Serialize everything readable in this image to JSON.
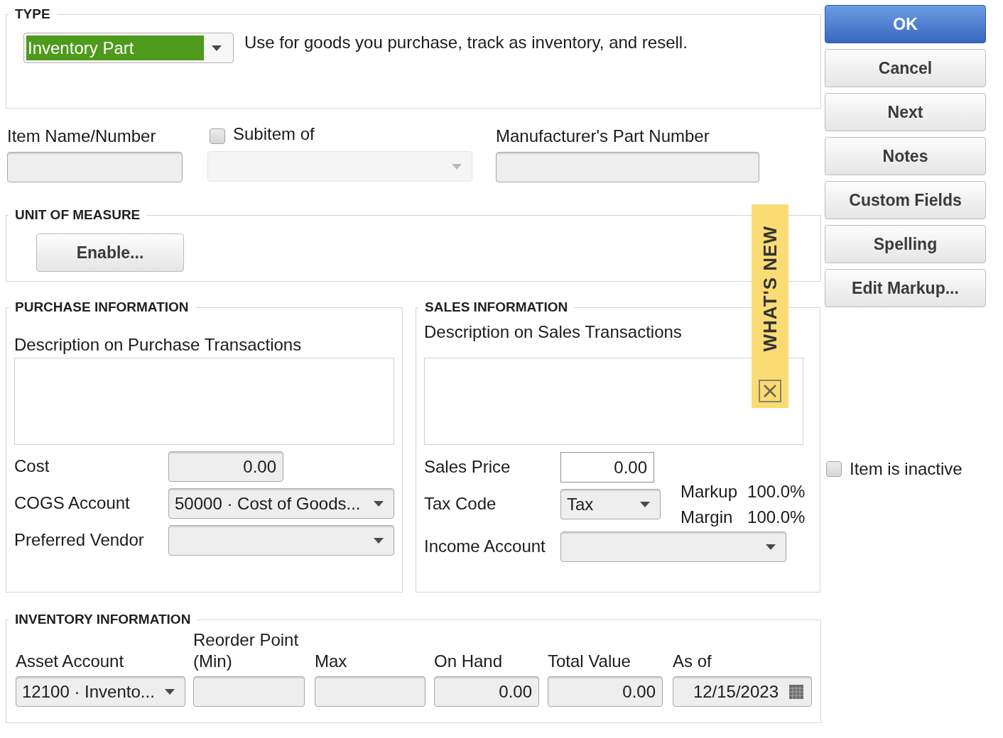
{
  "type_section": {
    "heading": "TYPE",
    "type_select": {
      "value": "Inventory Part",
      "focused": true
    },
    "description": "Use for goods you purchase, track as inventory, and resell."
  },
  "item_fields": {
    "item_name": {
      "label": "Item Name/Number"
    },
    "subitem": {
      "label": "Subitem of",
      "checked": false,
      "select_disabled": true
    },
    "manufacturer_part_number": {
      "label": "Manufacturer's Part Number"
    }
  },
  "unit_of_measure": {
    "heading": "UNIT OF MEASURE",
    "button": "Enable..."
  },
  "whats_new_tab": {
    "label": "WHAT'S NEW"
  },
  "purchase_information": {
    "heading": "PURCHASE INFORMATION",
    "description_label": "Description on Purchase Transactions",
    "fields": [
      {
        "label": "Cost",
        "kind": "number",
        "value": "0.00"
      },
      {
        "label": "COGS Account",
        "kind": "select",
        "value": "50000 · Cost of Goods..."
      },
      {
        "label": "Preferred Vendor",
        "kind": "select"
      }
    ]
  },
  "sales_information": {
    "heading": "SALES INFORMATION",
    "description_label": "Description on Sales Transactions",
    "sales_price": {
      "label": "Sales Price",
      "value": "0.00",
      "focused": true
    },
    "tax_code": {
      "label": "Tax Code",
      "value": "Tax"
    },
    "markup": [
      {
        "label": "Markup",
        "value": "100.0%"
      },
      {
        "label": "Margin",
        "value": "100.0%"
      }
    ],
    "income_account": {
      "label": "Income Account"
    }
  },
  "inventory_information": {
    "heading": "INVENTORY INFORMATION",
    "columns": [
      {
        "label": "Asset Account",
        "kind": "select",
        "value": "12100 · Invento..."
      },
      {
        "label": "Reorder Point (Min)",
        "kind": "text"
      },
      {
        "label": "Max",
        "kind": "text"
      },
      {
        "label": "On Hand",
        "kind": "number",
        "value": "0.00"
      },
      {
        "label": "Total Value",
        "kind": "number",
        "value": "0.00"
      },
      {
        "label": "As of",
        "kind": "date",
        "value": "12/15/2023"
      }
    ]
  },
  "buttons": [
    {
      "label": "OK",
      "primary": true
    },
    {
      "label": "Cancel",
      "primary": false
    },
    {
      "label": "Next",
      "primary": false
    },
    {
      "label": "Notes",
      "primary": false
    },
    {
      "label": "Custom Fields",
      "primary": false
    },
    {
      "label": "Spelling",
      "primary": false
    },
    {
      "label": "Edit Markup...",
      "primary": false
    }
  ],
  "item_inactive": {
    "label": "Item is inactive",
    "checked": false
  }
}
